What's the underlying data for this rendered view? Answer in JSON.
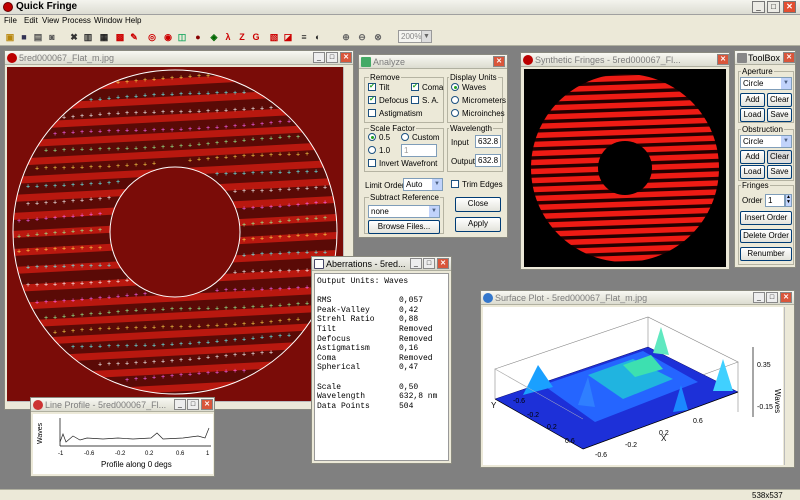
{
  "app": {
    "title": "Quick Fringe"
  },
  "menu": [
    "File",
    "Edit",
    "View",
    "Process",
    "Window",
    "Help"
  ],
  "toolbar": {
    "zoom": "200%",
    "letters": [
      "λ",
      "Z",
      "G"
    ]
  },
  "image_window": {
    "title": "5red000067_Flat_m.jpg"
  },
  "analyze": {
    "title": "Analyze",
    "remove_label": "Remove",
    "tilt": "Tilt",
    "coma": "Coma",
    "defocus": "Defocus",
    "sa": "S. A.",
    "astig": "Astigmatism",
    "display_units_label": "Display Units",
    "waves": "Waves",
    "micrometers": "Micrometers",
    "microinches": "Microinches",
    "scale_label": "Scale Factor",
    "s05": "0.5",
    "s10": "1.0",
    "custom": "Custom",
    "custom_value": "1",
    "invert": "Invert Wavefront",
    "wavelength_label": "Wavelength",
    "input_label": "Input",
    "input_value": "632.8",
    "output_label": "Output",
    "output_value": "632.8",
    "limit_label": "Limit Order",
    "limit_value": "Auto",
    "trim": "Trim Edges",
    "subtract_label": "Subtract Reference",
    "subtract_value": "none",
    "browse": "Browse Files...",
    "close": "Close",
    "apply": "Apply"
  },
  "synthetic": {
    "title": "Synthetic Fringes - 5red000067_Fl..."
  },
  "toolbox": {
    "title": "ToolBox",
    "aperture_label": "Aperture",
    "aperture_value": "Circle",
    "add": "Add",
    "clear": "Clear",
    "load": "Load",
    "save": "Save",
    "obstruction_label": "Obstruction",
    "obstruction_value": "Circle",
    "fringes_label": "Fringes",
    "order_label": "Order",
    "order_value": "1",
    "insert": "Insert Order",
    "delete": "Delete Order",
    "renumber": "Renumber"
  },
  "aberrations": {
    "title": "Aberrations - 5red...",
    "header": "Output Units: Waves",
    "rows": [
      {
        "k": "RMS",
        "v": "0,057"
      },
      {
        "k": "Peak-Valley",
        "v": "0,42"
      },
      {
        "k": "Strehl Ratio",
        "v": "0,88"
      },
      {
        "k": "Tilt",
        "v": "Removed"
      },
      {
        "k": "Defocus",
        "v": "Removed"
      },
      {
        "k": "Astigmatism",
        "v": "0,16"
      },
      {
        "k": "Coma",
        "v": "Removed"
      },
      {
        "k": "Spherical",
        "v": "0,47"
      }
    ],
    "rows2": [
      {
        "k": "Scale",
        "v": "0,50"
      },
      {
        "k": "Wavelength",
        "v": "632,8 nm"
      },
      {
        "k": "Data Points",
        "v": "504"
      }
    ]
  },
  "surface": {
    "title": "Surface Plot - 5red000067_Flat_m.jpg",
    "zlabel": "Waves",
    "xlabel": "X",
    "ylabel": "Y",
    "z_ticks": [
      "0.35",
      "-0.15"
    ],
    "y_ticks": [
      "-0.6",
      "-0.2",
      "0.2",
      "0.6"
    ],
    "x_ticks": [
      "-0.6",
      "-0.2",
      "0.2",
      "0.6"
    ]
  },
  "line_profile": {
    "title": "Line Profile - 5red000067_Fl...",
    "ylabel": "Waves",
    "xlabel": "Profile along 0 degs",
    "x_ticks": [
      "-1",
      "-0.6",
      "-0.2",
      "0.2",
      "0.6",
      "1"
    ]
  },
  "status": {
    "size": "538x537"
  }
}
